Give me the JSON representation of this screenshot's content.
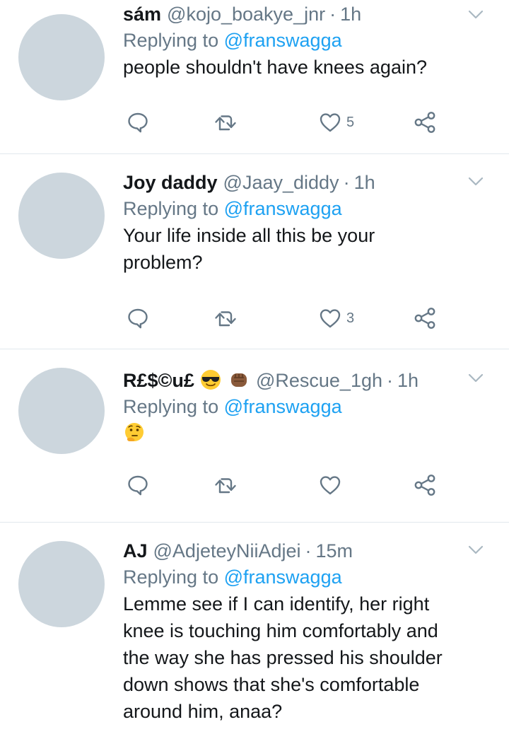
{
  "tweets": [
    {
      "name": "sám",
      "handle": "@kojo_boakye_jnr",
      "time": "1h",
      "replying_prefix": "Replying to",
      "replying_to": "@franswagga",
      "text": "people shouldn't have knees again?",
      "likes": "5"
    },
    {
      "name": "Joy daddy",
      "handle": "@Jaay_diddy",
      "time": "1h",
      "replying_prefix": "Replying to",
      "replying_to": "@franswagga",
      "text_lines": [
        "Your life inside all this be your",
        "problem?"
      ],
      "likes": "3"
    },
    {
      "name": "R£$©u£",
      "name_emojis": [
        "smiling-face-with-sunglasses",
        "oncoming-fist"
      ],
      "handle": "@Rescue_1gh",
      "time": "1h",
      "replying_prefix": "Replying to",
      "replying_to": "@franswagga",
      "text_emoji": "thinking-face",
      "likes": ""
    },
    {
      "name": "AJ",
      "handle": "@AdjeteyNiiAdjei",
      "time": "15m",
      "replying_prefix": "Replying to",
      "replying_to": "@franswagga",
      "text_lines": [
        "Lemme see if I can identify, her right",
        "knee is touching him comfortably and",
        "the way she has pressed his shoulder",
        "down shows that she's comfortable",
        "around him, anaa?"
      ]
    }
  ],
  "separator": "·",
  "colors": {
    "name": "#14171a",
    "secondary": "#657786",
    "link": "#1da1f2",
    "avatar": "#ccd6dd",
    "divider": "#e1e8ed"
  }
}
